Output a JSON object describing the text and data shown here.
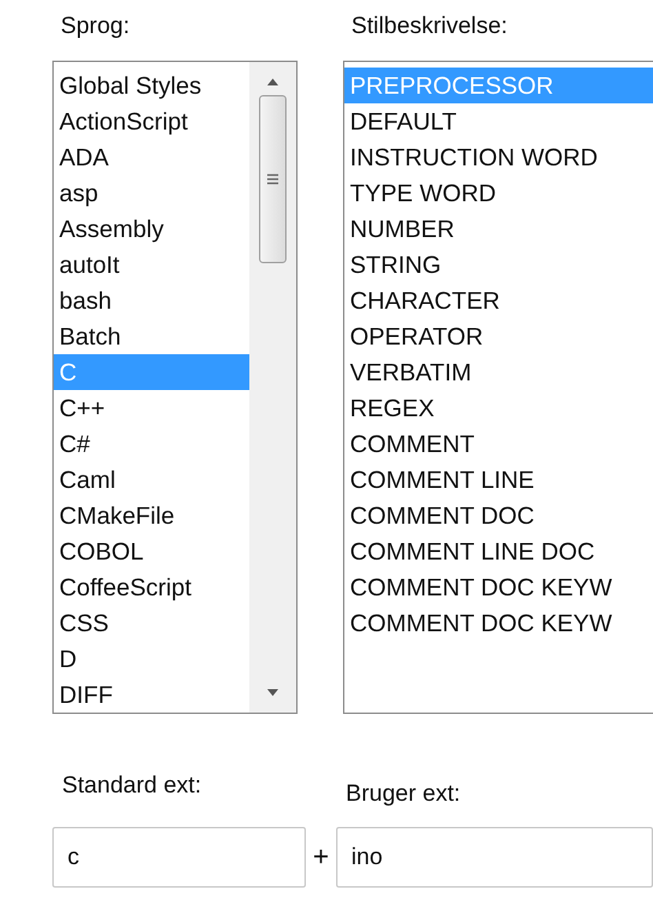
{
  "language_list": {
    "label": "Sprog:",
    "items": [
      {
        "label": "Global Styles",
        "selected": false
      },
      {
        "label": "ActionScript",
        "selected": false
      },
      {
        "label": "ADA",
        "selected": false
      },
      {
        "label": "asp",
        "selected": false
      },
      {
        "label": "Assembly",
        "selected": false
      },
      {
        "label": "autoIt",
        "selected": false
      },
      {
        "label": "bash",
        "selected": false
      },
      {
        "label": "Batch",
        "selected": false
      },
      {
        "label": "C",
        "selected": true
      },
      {
        "label": "C++",
        "selected": false
      },
      {
        "label": "C#",
        "selected": false
      },
      {
        "label": "Caml",
        "selected": false
      },
      {
        "label": "CMakeFile",
        "selected": false
      },
      {
        "label": "COBOL",
        "selected": false
      },
      {
        "label": "CoffeeScript",
        "selected": false
      },
      {
        "label": "CSS",
        "selected": false
      },
      {
        "label": "D",
        "selected": false
      },
      {
        "label": "DIFF",
        "selected": false
      }
    ]
  },
  "style_list": {
    "label": "Stilbeskrivelse:",
    "items": [
      {
        "label": "PREPROCESSOR",
        "selected": true
      },
      {
        "label": "DEFAULT",
        "selected": false
      },
      {
        "label": "INSTRUCTION WORD",
        "selected": false
      },
      {
        "label": "TYPE WORD",
        "selected": false
      },
      {
        "label": "NUMBER",
        "selected": false
      },
      {
        "label": "STRING",
        "selected": false
      },
      {
        "label": "CHARACTER",
        "selected": false
      },
      {
        "label": "OPERATOR",
        "selected": false
      },
      {
        "label": "VERBATIM",
        "selected": false
      },
      {
        "label": "REGEX",
        "selected": false
      },
      {
        "label": "COMMENT",
        "selected": false
      },
      {
        "label": "COMMENT LINE",
        "selected": false
      },
      {
        "label": "COMMENT DOC",
        "selected": false
      },
      {
        "label": "COMMENT LINE DOC",
        "selected": false
      },
      {
        "label": "COMMENT DOC KEYW",
        "selected": false
      },
      {
        "label": "COMMENT DOC KEYW",
        "selected": false
      }
    ]
  },
  "standard_ext": {
    "label": "Standard ext:",
    "value": "c"
  },
  "plus": "+",
  "user_ext": {
    "label": "Bruger ext:",
    "value": "ino"
  }
}
